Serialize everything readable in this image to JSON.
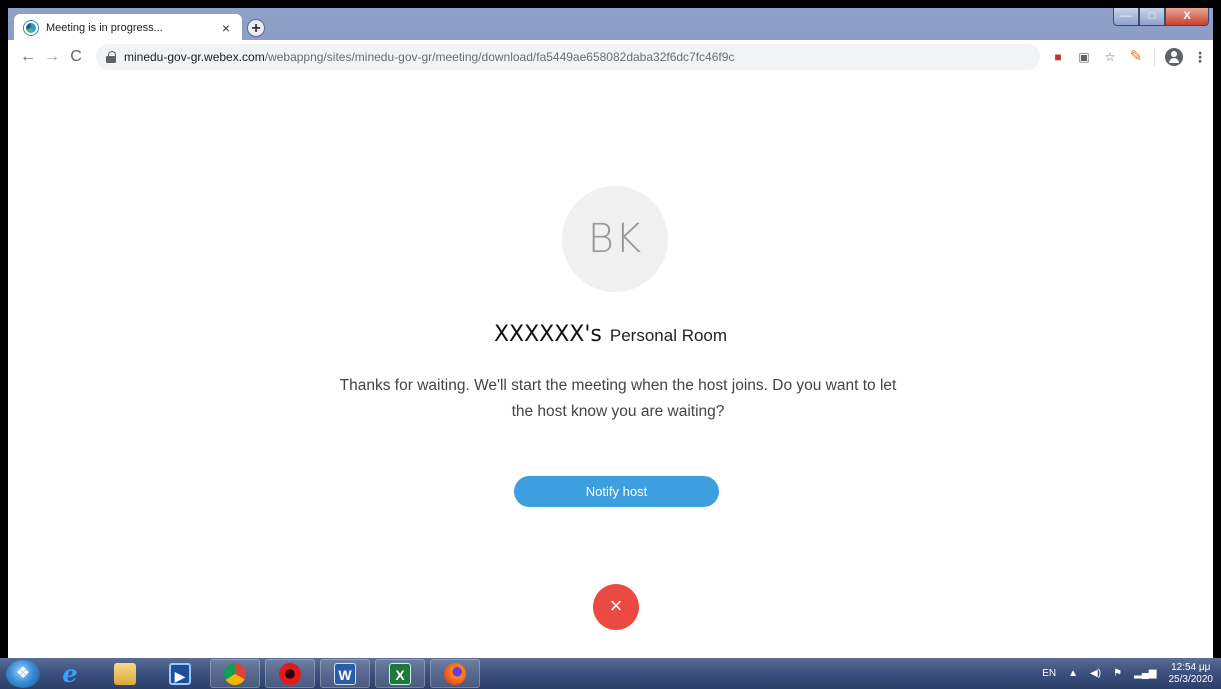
{
  "browser": {
    "tab_title": "Meeting is in progress...",
    "tab_close": "×",
    "new_tab": "+",
    "url_host": "minedu-gov-gr.webex.com",
    "url_path": "/webappng/sites/minedu-gov-gr/meeting/download/fa5449ae658082daba32f6dc7fc46f9c",
    "window_controls": {
      "minimize": "—",
      "maximize": "□",
      "close": "X"
    }
  },
  "meeting": {
    "avatar_initials": "BK",
    "room_owner": "XXXXXX's",
    "room_suffix": "Personal Room",
    "message": "Thanks for waiting. We'll start the meeting when the host joins. Do you want to let the host know you are waiting?",
    "notify_label": "Notify host",
    "leave_symbol": "×",
    "colors": {
      "notify": "#3e9fde",
      "leave": "#ea4a41"
    }
  },
  "taskbar": {
    "apps": [
      {
        "name": "internet-explorer",
        "glyph": "e"
      },
      {
        "name": "file-explorer",
        "glyph": ""
      },
      {
        "name": "media-player",
        "glyph": "▶"
      },
      {
        "name": "chrome",
        "glyph": ""
      },
      {
        "name": "opera",
        "glyph": ""
      },
      {
        "name": "word",
        "glyph": "W"
      },
      {
        "name": "excel",
        "glyph": "X"
      },
      {
        "name": "firefox",
        "glyph": ""
      }
    ],
    "language": "EN",
    "time": "12:54 μμ",
    "date": "25/3/2020"
  }
}
